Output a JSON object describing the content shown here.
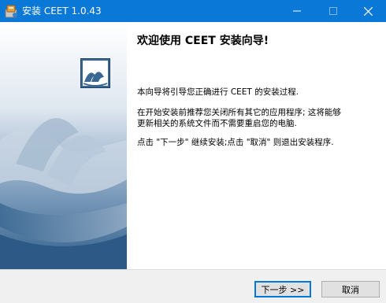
{
  "window": {
    "title": "安装 CEET 1.0.43"
  },
  "titlebar_icons": [
    "installer-icon",
    "minimize-icon",
    "maximize-icon",
    "close-icon"
  ],
  "content": {
    "heading": "欢迎使用 CEET 安装向导!",
    "paragraph1": "本向导将引导您正确进行 CEET 的安装过程.",
    "paragraph2_line1": "在开始安装前推荐您关闭所有其它的应用程序; 这将能够",
    "paragraph2_line2": "更新相关的系统文件而不需要重启您的电脑.",
    "paragraph3": "点击 \"下一步\" 继续安装;点击 \"取消\" 则退出安装程序."
  },
  "buttons": {
    "next": "下一步 >>",
    "cancel": "取消"
  },
  "colors": {
    "titlebar": "#0a78d7",
    "banner_top": "#ffffff",
    "banner_bottom": "#2f5e8a",
    "button_focus": "#0078d7"
  }
}
